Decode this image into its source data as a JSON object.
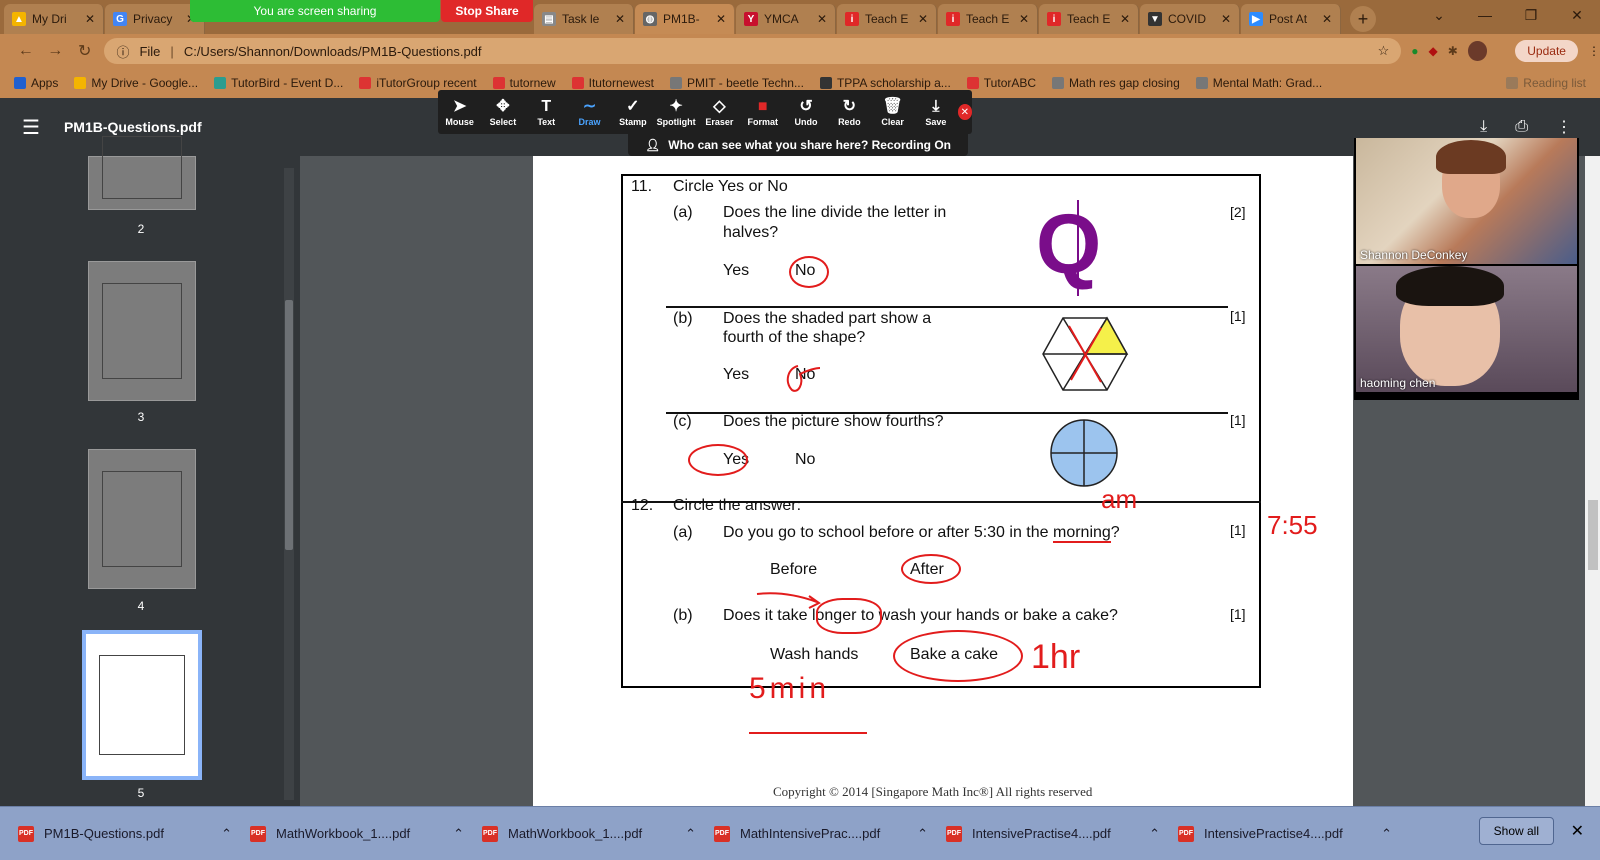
{
  "browser": {
    "tabs": [
      {
        "label": "My Dri",
        "icon": "google-drive-icon",
        "color": "#f4b400"
      },
      {
        "label": "Privacy",
        "icon": "google-icon",
        "color": "#4285f4"
      },
      {
        "label": "Task le",
        "icon": "doc-icon",
        "color": "#888888"
      },
      {
        "label": "PM1B-",
        "icon": "globe-icon",
        "color": "#666666"
      },
      {
        "label": "YMCA",
        "icon": "ymca-icon",
        "color": "#c8102e"
      },
      {
        "label": "Teach E",
        "icon": "itutor-icon",
        "color": "#e02828"
      },
      {
        "label": "Teach E",
        "icon": "itutor-icon",
        "color": "#e02828"
      },
      {
        "label": "Teach E",
        "icon": "itutor-icon",
        "color": "#e02828"
      },
      {
        "label": "COVID",
        "icon": "brave-icon",
        "color": "#333333"
      },
      {
        "label": "Post At",
        "icon": "zoom-icon",
        "color": "#2d8cff"
      }
    ],
    "share_banner": "You are screen sharing",
    "stop_share": "Stop Share",
    "address": {
      "scheme": "File",
      "url": "C:/Users/Shannon/Downloads/PM1B-Questions.pdf"
    },
    "update_label": "Update",
    "bookmarks": [
      "Apps",
      "My Drive - Google...",
      "TutorBird - Event D...",
      "iTutorGroup recent",
      "tutornew",
      "Itutornewest",
      "PMIT - beetle Techn...",
      "TPPA scholarship a...",
      "TutorABC",
      "Math res gap closing",
      "Mental Math: Grad...",
      "Reading list"
    ]
  },
  "annot_toolbar": {
    "tools": [
      "Mouse",
      "Select",
      "Text",
      "Draw",
      "Stamp",
      "Spotlight",
      "Eraser",
      "Format",
      "Undo",
      "Redo",
      "Clear",
      "Save"
    ],
    "active": "Draw",
    "recording_text": "Who can see what you share here? Recording On"
  },
  "pdf": {
    "title": "PM1B-Questions.pdf",
    "thumbnails": [
      "2",
      "3",
      "4",
      "5"
    ],
    "q11": {
      "num": "11.",
      "title": "Circle Yes or No",
      "a": {
        "label": "(a)",
        "line1": "Does the line divide the letter in",
        "line2": "halves?",
        "yes": "Yes",
        "no": "No",
        "mark": "[2]",
        "letter": "Q"
      },
      "b": {
        "label": "(b)",
        "line1": "Does the shaded part show a",
        "line2": "fourth of the shape?",
        "yes": "Yes",
        "no": "No",
        "mark": "[1]"
      },
      "c": {
        "label": "(c)",
        "line1": "Does the picture show fourths?",
        "yes": "Yes",
        "no": "No",
        "mark": "[1]"
      }
    },
    "q12": {
      "num": "12.",
      "title": "Circle the answer:",
      "a": {
        "label": "(a)",
        "text_before": "Do you go to school before or after 5:30 in the ",
        "text_word": "morning",
        "text_after": "?",
        "opt1": "Before",
        "opt2": "After",
        "mark": "[1]"
      },
      "b": {
        "label": "(b)",
        "text_before": "Does it take ",
        "text_word": "longer",
        "text_after": " to wash your hands or bake a cake?",
        "opt1": "Wash hands",
        "opt2": "Bake a cake",
        "mark": "[1]"
      }
    },
    "ink": {
      "am": "am",
      "time": "7:55",
      "hr": "1hr",
      "min": "5min"
    },
    "copyright": "Copyright © 2014 [Singapore Math Inc®] All rights reserved"
  },
  "video": {
    "participants": [
      {
        "name": "Shannon DeConkey"
      },
      {
        "name": "haoming   chen"
      }
    ]
  },
  "downloads": {
    "items": [
      "PM1B-Questions.pdf",
      "MathWorkbook_1....pdf",
      "MathWorkbook_1....pdf",
      "MathIntensivePrac....pdf",
      "IntensivePractise4....pdf",
      "IntensivePractise4....pdf"
    ],
    "show_all": "Show all"
  }
}
